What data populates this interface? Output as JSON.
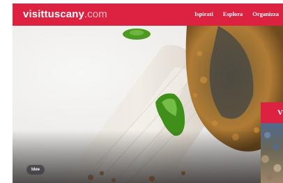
{
  "header": {
    "logo": {
      "name": "visittuscany",
      "tld": ".com"
    },
    "nav": [
      {
        "label": "Ispirati"
      },
      {
        "label": "Esplora"
      },
      {
        "label": "Organizza"
      }
    ]
  },
  "hero": {
    "tag": "Idee"
  },
  "side_card": {
    "title": "V"
  },
  "colors": {
    "brand_red": "#dd2140",
    "white": "#ffffff"
  },
  "icons": []
}
